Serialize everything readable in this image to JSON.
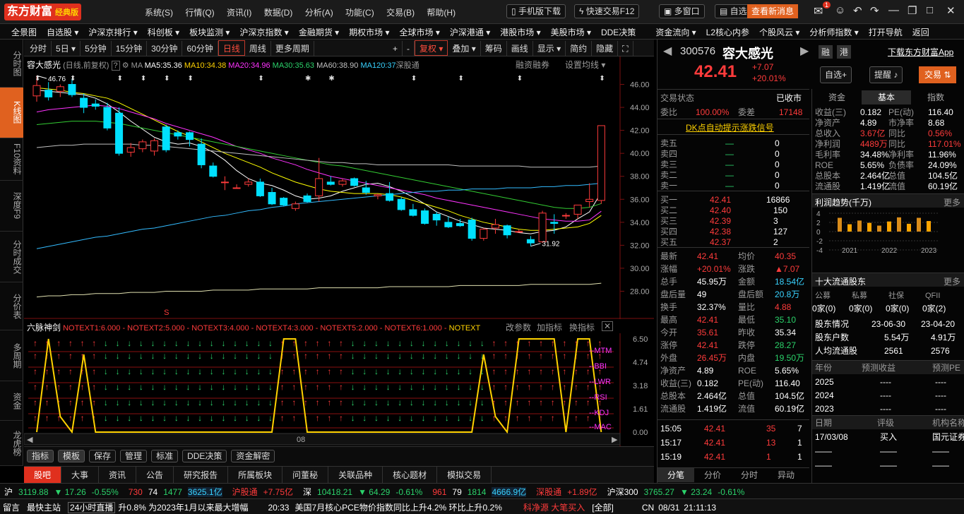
{
  "app": {
    "logo": "东方财富",
    "edition": "经典版",
    "menus": [
      "系统(S)",
      "行情(Q)",
      "资讯(I)",
      "数据(D)",
      "分析(A)",
      "功能(C)",
      "交易(B)",
      "帮助(H)"
    ],
    "top_buttons": {
      "mobile": "手机版下载",
      "quicktrade": "快速交易F12",
      "multiwin": "多窗口",
      "self": "自选",
      "news": "查看新消息",
      "mail_badge": "1"
    }
  },
  "market_menu": [
    "全景图",
    "自选股 ▾",
    "沪深京排行 ▾",
    "科创板 ▾",
    "板块监测 ▾",
    "沪深京指数 ▾",
    "金融期货 ▾",
    "期权市场 ▾",
    "全球市场 ▾",
    "沪深港通 ▾",
    "港股市场 ▾",
    "美股市场 ▾",
    "DDE决策",
    "资金流向 ▾",
    "L2核心内参",
    "个股风云 ▾",
    "分析师指数 ▾",
    "打开导航",
    "返回"
  ],
  "left_nav": [
    "分时图",
    "K线图",
    "F10资料",
    "深度F9",
    "分时成交",
    "分价表",
    "多周期",
    "资金",
    "龙虎榜"
  ],
  "toolbar": {
    "items": [
      "分时",
      "5日 ▾",
      "5分钟",
      "15分钟",
      "30分钟",
      "60分钟",
      "日线",
      "周线",
      "更多周期"
    ],
    "active": "日线",
    "right": [
      "+",
      "-",
      "复权 ▾",
      "叠加 ▾",
      "筹码",
      "画线",
      "显示 ▾",
      "简约",
      "隐藏"
    ]
  },
  "chart_info": {
    "name": "容大感光",
    "mode": "(日线,前复权)",
    "ma": "MA",
    "ma5": "MA5:35.36",
    "ma10": "MA10:34.38",
    "ma20": "MA20:34.96",
    "ma30": "MA30:35.63",
    "ma60": "MA60:38.90",
    "ma120": "MA120:37",
    "tag1": "深股通",
    "tag2": "融资融券",
    "setting": "设置均线 ▾",
    "high_label": "46.76",
    "low_label": "31.92"
  },
  "chart_data": {
    "type": "candlestick",
    "y_ticks": [
      46,
      44,
      42,
      40,
      38,
      36,
      34,
      32,
      30,
      28
    ],
    "ylim": [
      26.8,
      47.2
    ],
    "candles": [
      [
        45.0,
        46.76,
        44.5,
        45.9
      ],
      [
        45.5,
        46.2,
        44.6,
        44.9
      ],
      [
        45.4,
        46.0,
        44.9,
        45.8
      ],
      [
        46.0,
        46.5,
        44.9,
        45.1
      ],
      [
        44.8,
        45.2,
        43.5,
        44.0
      ],
      [
        44.3,
        44.7,
        43.8,
        44.1
      ],
      [
        44.0,
        44.4,
        42.0,
        42.2
      ],
      [
        43.5,
        44.0,
        39.8,
        40.0
      ],
      [
        40.1,
        40.9,
        39.7,
        40.5
      ],
      [
        40.4,
        41.2,
        40.1,
        41.0
      ],
      [
        40.2,
        41.3,
        39.8,
        41.1
      ],
      [
        42.3,
        42.5,
        40.1,
        40.3
      ],
      [
        41.8,
        42.0,
        41.2,
        41.5
      ],
      [
        41.8,
        41.9,
        40.6,
        41.2
      ],
      [
        40.8,
        41.3,
        38.7,
        39.0
      ],
      [
        38.9,
        39.2,
        37.9,
        38.0
      ],
      [
        37.5,
        38.0,
        36.8,
        37.5
      ],
      [
        37.0,
        37.3,
        37.0,
        37.0
      ],
      [
        37.3,
        37.8,
        37.1,
        37.5
      ],
      [
        37.5,
        37.8,
        36.2,
        36.3
      ],
      [
        36.6,
        37.0,
        35.5,
        35.6
      ],
      [
        36.1,
        36.2,
        35.4,
        35.5
      ],
      [
        35.2,
        35.8,
        35.0,
        35.6
      ],
      [
        36.3,
        36.5,
        35.7,
        35.8
      ],
      [
        36.3,
        39.6,
        35.8,
        37.8
      ],
      [
        37.5,
        38.0,
        37.2,
        37.3
      ],
      [
        37.3,
        37.8,
        37.1,
        37.6
      ],
      [
        37.8,
        37.9,
        37.1,
        37.2
      ],
      [
        37.0,
        37.6,
        36.4,
        36.6
      ],
      [
        36.3,
        36.5,
        36.0,
        36.4
      ],
      [
        36.5,
        37.5,
        35.8,
        35.9
      ],
      [
        36.0,
        36.2,
        35.0,
        35.1
      ],
      [
        35.1,
        35.6,
        34.5,
        34.6
      ],
      [
        35.0,
        35.2,
        33.8,
        33.9
      ],
      [
        34.7,
        34.9,
        33.7,
        34.2
      ],
      [
        34.0,
        34.5,
        33.5,
        33.6
      ],
      [
        33.9,
        34.3,
        33.6,
        33.7
      ],
      [
        34.2,
        34.4,
        32.4,
        32.6
      ],
      [
        32.6,
        33.5,
        32.4,
        33.4
      ],
      [
        33.5,
        34.3,
        33.0,
        33.8
      ],
      [
        33.7,
        33.8,
        32.6,
        32.9
      ],
      [
        33.2,
        33.4,
        33.1,
        33.2
      ],
      [
        32.5,
        32.8,
        31.92,
        32.2
      ],
      [
        32.3,
        35.0,
        32.2,
        34.8
      ],
      [
        34.0,
        34.7,
        33.0,
        33.9
      ],
      [
        34.6,
        34.8,
        34.3,
        34.6
      ],
      [
        34.7,
        35.3,
        34.3,
        35.5
      ],
      [
        35.8,
        37.4,
        35.3,
        36.0
      ],
      [
        35.9,
        42.41,
        35.6,
        42.41
      ]
    ],
    "ma": [
      {
        "name": "MA5",
        "color": "#ffffff",
        "values": [
          45.5,
          45.4,
          45.3,
          45.2,
          45.1,
          44.8,
          44.3,
          43.6,
          42.8,
          42.1,
          41.4,
          41.0,
          40.8,
          40.9,
          40.6,
          40.1,
          39.4,
          38.5,
          37.8,
          37.4,
          37.2,
          36.8,
          36.3,
          36.0,
          36.1,
          36.3,
          36.7,
          37.0,
          37.3,
          37.4,
          37.1,
          36.7,
          36.2,
          35.6,
          34.9,
          34.5,
          34.1,
          33.8,
          33.5,
          33.4,
          33.3,
          33.1,
          33.0,
          33.2,
          33.3,
          33.6,
          34.3,
          34.9,
          36.6
        ]
      },
      {
        "name": "MA10",
        "color": "#ffff00",
        "values": [
          45.7,
          45.6,
          45.5,
          45.3,
          45.2,
          45.0,
          44.8,
          44.4,
          43.9,
          43.4,
          42.9,
          42.4,
          41.9,
          41.5,
          41.0,
          40.5,
          40.0,
          39.6,
          39.2,
          38.8,
          38.3,
          37.9,
          37.5,
          37.2,
          36.9,
          36.7,
          36.6,
          36.5,
          36.5,
          36.5,
          36.4,
          36.2,
          35.9,
          35.6,
          35.3,
          35.0,
          34.6,
          34.3,
          34.0,
          33.8,
          33.6,
          33.4,
          33.3,
          33.3,
          33.4,
          33.5,
          33.6,
          33.9,
          34.6
        ]
      },
      {
        "name": "MA20",
        "color": "#ff33ff",
        "values": [
          43.6,
          43.8,
          43.9,
          44.0,
          44.1,
          44.2,
          44.1,
          43.9,
          43.6,
          43.3,
          43.0,
          42.6,
          42.3,
          42.0,
          41.7,
          41.4,
          41.0,
          40.6,
          40.3,
          40.0,
          39.6,
          39.3,
          39.0,
          38.6,
          38.3,
          38.0,
          37.8,
          37.6,
          37.4,
          37.2,
          37.0,
          36.8,
          36.6,
          36.4,
          36.1,
          35.9,
          35.7,
          35.5,
          35.3,
          35.1,
          34.9,
          34.7,
          34.5,
          34.3,
          34.2,
          34.1,
          34.1,
          34.2,
          34.96
        ]
      },
      {
        "name": "MA30",
        "color": "#33cc33",
        "values": [
          42.5,
          42.6,
          42.7,
          42.8,
          42.8,
          42.8,
          42.7,
          42.6,
          42.4,
          42.2,
          42.0,
          41.8,
          41.6,
          41.4,
          41.2,
          41.0,
          40.8,
          40.6,
          40.4,
          40.2,
          40.0,
          39.8,
          39.6,
          39.4,
          39.2,
          39.0,
          38.9,
          38.7,
          38.5,
          38.3,
          38.1,
          37.9,
          37.7,
          37.5,
          37.3,
          37.1,
          36.9,
          36.7,
          36.5,
          36.3,
          36.1,
          35.9,
          35.7,
          35.5,
          35.3,
          35.2,
          35.2,
          35.3,
          35.63
        ]
      },
      {
        "name": "MA60",
        "color": "#c0c0c0",
        "values": [
          40.5,
          40.6,
          40.7,
          40.7,
          40.8,
          40.8,
          40.8,
          40.8,
          40.8,
          40.7,
          40.7,
          40.6,
          40.5,
          40.4,
          40.3,
          40.2,
          40.1,
          40.0,
          39.9,
          39.8,
          39.7,
          39.6,
          39.5,
          39.4,
          39.3,
          39.2,
          39.2,
          39.1,
          39.1,
          39.0,
          39.0,
          39.0,
          39.0,
          39.0,
          39.0,
          39.0,
          38.9,
          38.9,
          38.9,
          38.9,
          38.9,
          38.9,
          38.8,
          38.8,
          38.8,
          38.8,
          38.8,
          38.8,
          38.9
        ]
      },
      {
        "name": "MA120",
        "color": "#33bbff",
        "values": [
          31.7,
          31.9,
          32.1,
          32.3,
          32.5,
          32.7,
          32.8,
          33.0,
          33.2,
          33.4,
          33.5,
          33.7,
          33.9,
          34.1,
          34.3,
          34.5,
          34.6,
          34.8,
          35.0,
          35.1,
          35.3,
          35.4,
          35.6,
          35.7,
          35.8,
          35.9,
          36.0,
          36.1,
          36.2,
          36.3,
          36.4,
          36.5,
          36.6,
          36.7,
          36.7,
          36.8,
          36.8,
          36.9,
          36.9,
          36.9,
          37.0,
          37.0,
          37.0,
          37.1,
          37.1,
          37.2,
          37.2,
          37.3,
          37.4
        ]
      },
      {
        "name": "MA250",
        "color": "#e0e0b0",
        "values": [
          27.5,
          27.6,
          27.6,
          27.7,
          27.7,
          27.8,
          27.8,
          27.8,
          27.9,
          27.9,
          27.9,
          28.0,
          28.0,
          28.0,
          28.0,
          28.1,
          28.1,
          28.1,
          28.1,
          28.2,
          28.2,
          28.2,
          28.2,
          28.2,
          28.3,
          28.3,
          28.3,
          28.3,
          28.3,
          28.3,
          28.4,
          28.4,
          28.4,
          28.4,
          28.4,
          28.4,
          28.5,
          28.5,
          28.5,
          28.5,
          28.5,
          28.5,
          28.6,
          28.6,
          28.6,
          28.6,
          28.6,
          28.6,
          28.7
        ]
      }
    ]
  },
  "indicator": {
    "name": "六脉神剑",
    "params": "NOTEXT1:6.000 - NOTEXT2:5.000 - NOTEXT3:4.000 - NOTEXT4:3.000 - NOTEXT5:2.000 - NOTEXT6:1.000 -",
    "right_tag": "NOTEXT",
    "modify": "改参数",
    "add": "加指标",
    "switch": "换指标",
    "y_ticks": [
      "6.50",
      "4.74",
      "3.18",
      "1.61",
      "0.00"
    ],
    "labels": [
      "MTM",
      "BBI",
      "LWR",
      "RSI",
      "KDJ",
      "MAC"
    ],
    "x_label": "08"
  },
  "bottom_tabs": [
    "指标",
    "模板",
    "保存",
    "管理",
    "标准",
    "DDE决策",
    "资金解密"
  ],
  "bottom_tabs2": [
    "股吧",
    "大事",
    "资讯",
    "公告",
    "研究报告",
    "所属板块",
    "问董秘",
    "关联品种",
    "核心题材",
    "模拟交易"
  ],
  "quote": {
    "code": "300576",
    "name": "容大感光",
    "price": "42.41",
    "change": "+7.07",
    "pct": "+20.01%",
    "tags": [
      "融",
      "港"
    ],
    "download": "下载东方财富App",
    "self_btn": "自选+",
    "remind": "提醒",
    "trade": "交易",
    "status_label": "交易状态",
    "status": "已收市",
    "weibi_label": "委比",
    "weibi": "100.00%",
    "weicha_label": "委差",
    "weicha": "17148",
    "signal": "DK点自动提示涨跌信号",
    "sells": [
      [
        "卖五",
        "—",
        "0"
      ],
      [
        "卖四",
        "—",
        "0"
      ],
      [
        "卖三",
        "—",
        "0"
      ],
      [
        "卖二",
        "—",
        "0"
      ],
      [
        "卖一",
        "—",
        "0"
      ]
    ],
    "buys": [
      [
        "买一",
        "42.41",
        "16866"
      ],
      [
        "买二",
        "42.40",
        "150"
      ],
      [
        "买三",
        "42.39",
        "3"
      ],
      [
        "买四",
        "42.38",
        "127"
      ],
      [
        "买五",
        "42.37",
        "2"
      ]
    ],
    "stats": [
      [
        "最新",
        "42.41",
        "均价",
        "40.35"
      ],
      [
        "涨幅",
        "+20.01%",
        "涨跌",
        "▲7.07"
      ],
      [
        "总手",
        "45.95万",
        "金额",
        "18.54亿"
      ],
      [
        "盘后量",
        "49",
        "盘后额",
        "20.8万"
      ],
      [
        "换手",
        "32.37%",
        "量比",
        "4.88"
      ],
      [
        "最高",
        "42.41",
        "最低",
        "35.10"
      ],
      [
        "今开",
        "35.61",
        "昨收",
        "35.34"
      ],
      [
        "涨停",
        "42.41",
        "跌停",
        "28.27"
      ],
      [
        "外盘",
        "26.45万",
        "内盘",
        "19.50万"
      ],
      [
        "净资产",
        "4.89",
        "ROE",
        "5.65%"
      ],
      [
        "收益(三)",
        "0.182",
        "PE(动)",
        "116.40"
      ],
      [
        "总股本",
        "2.464亿",
        "总值",
        "104.5亿"
      ],
      [
        "流通股",
        "1.419亿",
        "流值",
        "60.19亿"
      ]
    ],
    "trades": [
      [
        "15:05",
        "42.41",
        "35",
        "7"
      ],
      [
        "15:17",
        "42.41",
        "13",
        "1"
      ],
      [
        "15:19",
        "42.41",
        "1",
        "1"
      ]
    ],
    "bottom_tabs": [
      "分笔",
      "分价",
      "分时",
      "异动"
    ]
  },
  "fund": {
    "tabs": [
      "资金",
      "基本",
      "指数"
    ],
    "active": "基本",
    "rows": [
      [
        "收益(三)",
        "0.182",
        "PE(动)",
        "116.40"
      ],
      [
        "净资产",
        "4.89",
        "市净率",
        "8.68"
      ],
      [
        "总收入",
        "3.67亿",
        "同比",
        "0.56%"
      ],
      [
        "净利润",
        "4489万",
        "同比",
        "117.01%"
      ],
      [
        "毛利率",
        "34.48%",
        "净利率",
        "11.96%"
      ],
      [
        "ROE",
        "5.65%",
        "负债率",
        "24.09%"
      ],
      [
        "总股本",
        "2.464亿",
        "总值",
        "104.5亿"
      ],
      [
        "流通股",
        "1.419亿",
        "流值",
        "60.19亿"
      ]
    ],
    "profit_title": "利润趋势(千万)",
    "more": "更多",
    "profit_y": [
      "4",
      "2",
      "0",
      "-2",
      "-4"
    ],
    "profit_x": [
      "2021",
      "2022",
      "2023"
    ],
    "profit_bars": [
      3.0,
      1.6,
      2.4,
      1.9,
      1.3,
      2.2,
      3.1,
      1.7,
      3.0,
      2.3
    ],
    "holders_title": "十大流通股东",
    "holder_head": [
      "公募",
      "私募",
      "社保",
      "QFII"
    ],
    "holder_vals": [
      "0家(0)",
      "0家(0)",
      "0家(0)",
      "0家(2)"
    ],
    "holder_rows": [
      [
        "股东情况",
        "23-06-30",
        "23-04-20"
      ],
      [
        "股东户数",
        "5.54万",
        "4.91万"
      ],
      [
        "人均流通股",
        "2561",
        "2576"
      ]
    ],
    "forecast_head": [
      "年份",
      "预测收益",
      "预测PE"
    ],
    "forecast_rows": [
      [
        "2025",
        "----",
        "----"
      ],
      [
        "2024",
        "----",
        "----"
      ],
      [
        "2023",
        "----",
        "----"
      ]
    ],
    "rating_head": [
      "日期",
      "评级",
      "机构名称"
    ],
    "rating_rows": [
      [
        "17/03/08",
        "买入",
        "国元证券"
      ],
      [
        "——",
        "——",
        "——"
      ],
      [
        "——",
        "——",
        "——"
      ]
    ]
  },
  "status": {
    "sh": "沪",
    "sh_val": "3119.88",
    "sh_chg": "▼ 17.26",
    "sh_pct": "-0.55%",
    "sh_up": "730",
    "sh_flat": "74",
    "sh_down": "1477",
    "sh_amt": "3625.1亿",
    "hgt": "沪股通",
    "hgt_val": "+7.75亿",
    "sz": "深",
    "sz_val": "10418.21",
    "sz_chg": "▼ 64.29",
    "sz_pct": "-0.61%",
    "sz_up": "961",
    "sz_flat": "79",
    "sz_down": "1814",
    "sz_amt": "4666.9亿",
    "sgt": "深股通",
    "sgt_val": "+1.89亿",
    "hs300": "沪深300",
    "hs_val": "3765.27",
    "hs_chg": "▼ 23.24",
    "hs_pct": "-0.61%"
  },
  "news": {
    "msg": "留言",
    "fast": "最快主站",
    "live": "24小时直播",
    "text1": "升0.8% 为2023年1月以来最大增幅",
    "time": "20:33",
    "text2": "美国7月核心PCE物价指数同比上升4.2% 环比上升0.2%",
    "flow": "科净源 大笔买入",
    "all": "[全部]",
    "cn": "CN",
    "date": "08/31",
    "clock": "21:11:13"
  }
}
